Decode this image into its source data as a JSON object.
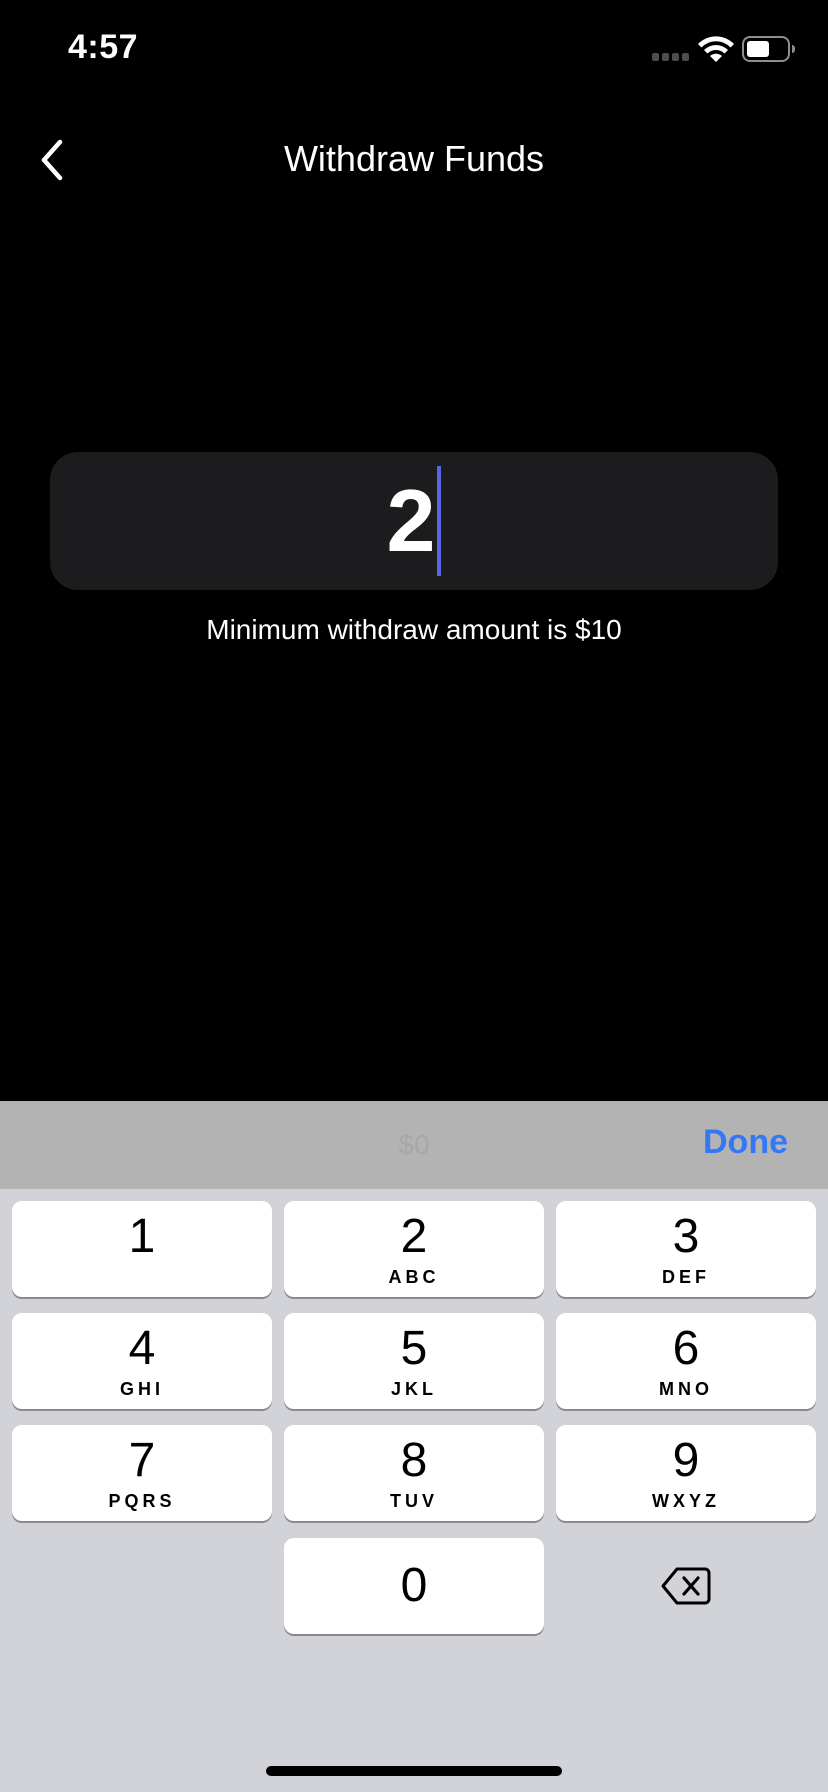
{
  "status_bar": {
    "time": "4:57"
  },
  "nav": {
    "title": "Withdraw Funds",
    "back_icon": "chevron-left-icon"
  },
  "amount": {
    "value": "2",
    "hint": "Minimum withdraw amount is $10"
  },
  "keyboard": {
    "placeholder": "$0",
    "done_label": "Done",
    "keys": [
      {
        "digit": "1",
        "letters": ""
      },
      {
        "digit": "2",
        "letters": "ABC"
      },
      {
        "digit": "3",
        "letters": "DEF"
      },
      {
        "digit": "4",
        "letters": "GHI"
      },
      {
        "digit": "5",
        "letters": "JKL"
      },
      {
        "digit": "6",
        "letters": "MNO"
      },
      {
        "digit": "7",
        "letters": "PQRS"
      },
      {
        "digit": "8",
        "letters": "TUV"
      },
      {
        "digit": "9",
        "letters": "WXYZ"
      },
      {
        "digit": "0",
        "letters": ""
      }
    ],
    "delete_icon": "backspace-icon"
  },
  "colors": {
    "background": "#000000",
    "field_background": "#1c1c1e",
    "caret": "#5b63e6",
    "done": "#3478f6",
    "keyboard_background": "#d1d3d9",
    "accessory_background": "#b3b3b3"
  }
}
